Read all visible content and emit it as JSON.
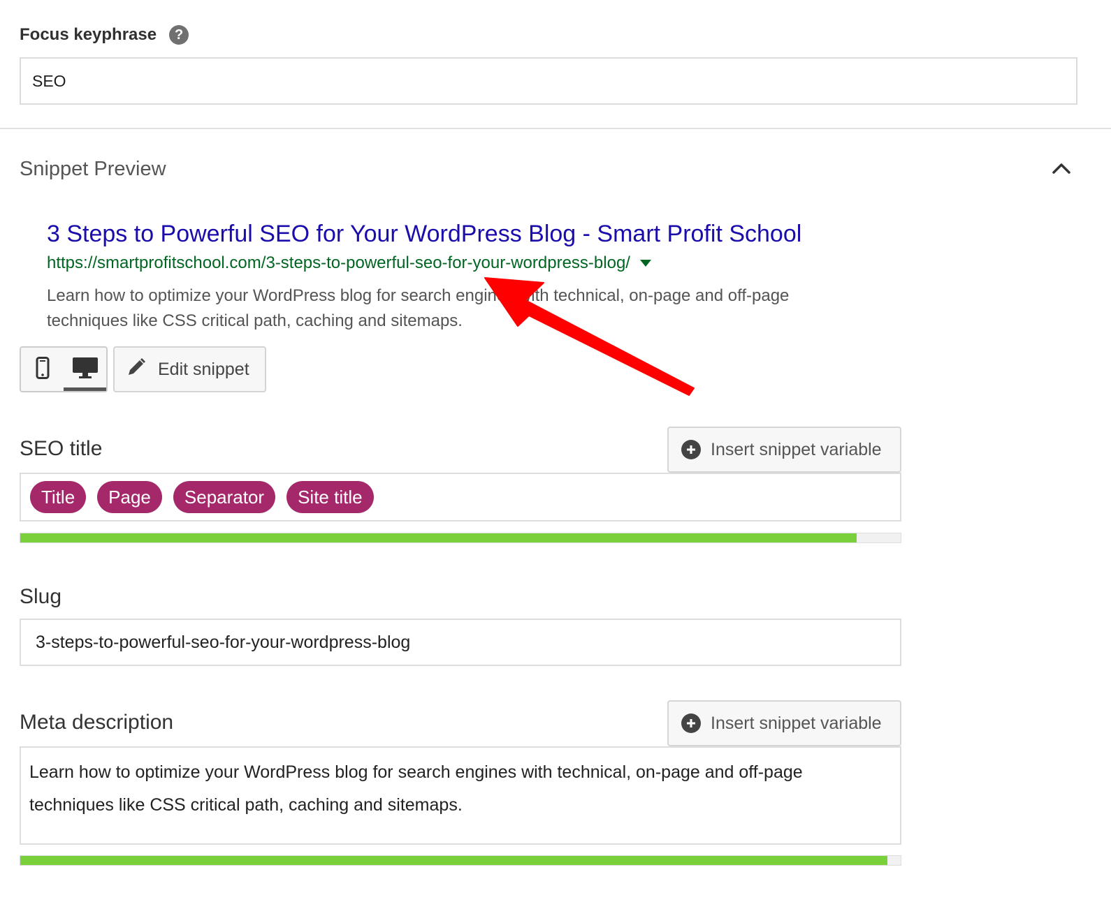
{
  "focus_keyphrase": {
    "label": "Focus keyphrase",
    "help_icon": "question-icon",
    "value": "SEO"
  },
  "snippet_preview": {
    "heading": "Snippet Preview",
    "collapse_icon": "chevron-up-icon",
    "serp": {
      "title": "3 Steps to Powerful SEO for Your WordPress Blog - Smart Profit School",
      "url": "https://smartprofitschool.com/3-steps-to-powerful-seo-for-your-wordpress-blog/",
      "description": "Learn how to optimize your WordPress blog for search engines with technical, on-page and off-page techniques like CSS critical path, caching and sitemaps."
    },
    "mode_buttons": [
      {
        "icon": "mobile-icon",
        "active": false
      },
      {
        "icon": "desktop-icon",
        "active": true
      }
    ],
    "edit_button_label": "Edit snippet"
  },
  "seo_title": {
    "label": "SEO title",
    "insert_button_label": "Insert snippet variable",
    "pills": [
      "Title",
      "Page",
      "Separator",
      "Site title"
    ],
    "progress": 0.95
  },
  "slug": {
    "label": "Slug",
    "value": "3-steps-to-powerful-seo-for-your-wordpress-blog"
  },
  "meta_description": {
    "label": "Meta description",
    "insert_button_label": "Insert snippet variable",
    "value": "Learn how to optimize your WordPress blog for search engines with technical, on-page and off-page techniques like CSS critical path, caching and sitemaps.",
    "progress": 0.985
  },
  "colors": {
    "pill": "#a4286a",
    "progress_good": "#7ad03a",
    "serp_title": "#1a0dab",
    "serp_url": "#006621",
    "annotation_arrow": "#ff0000"
  }
}
